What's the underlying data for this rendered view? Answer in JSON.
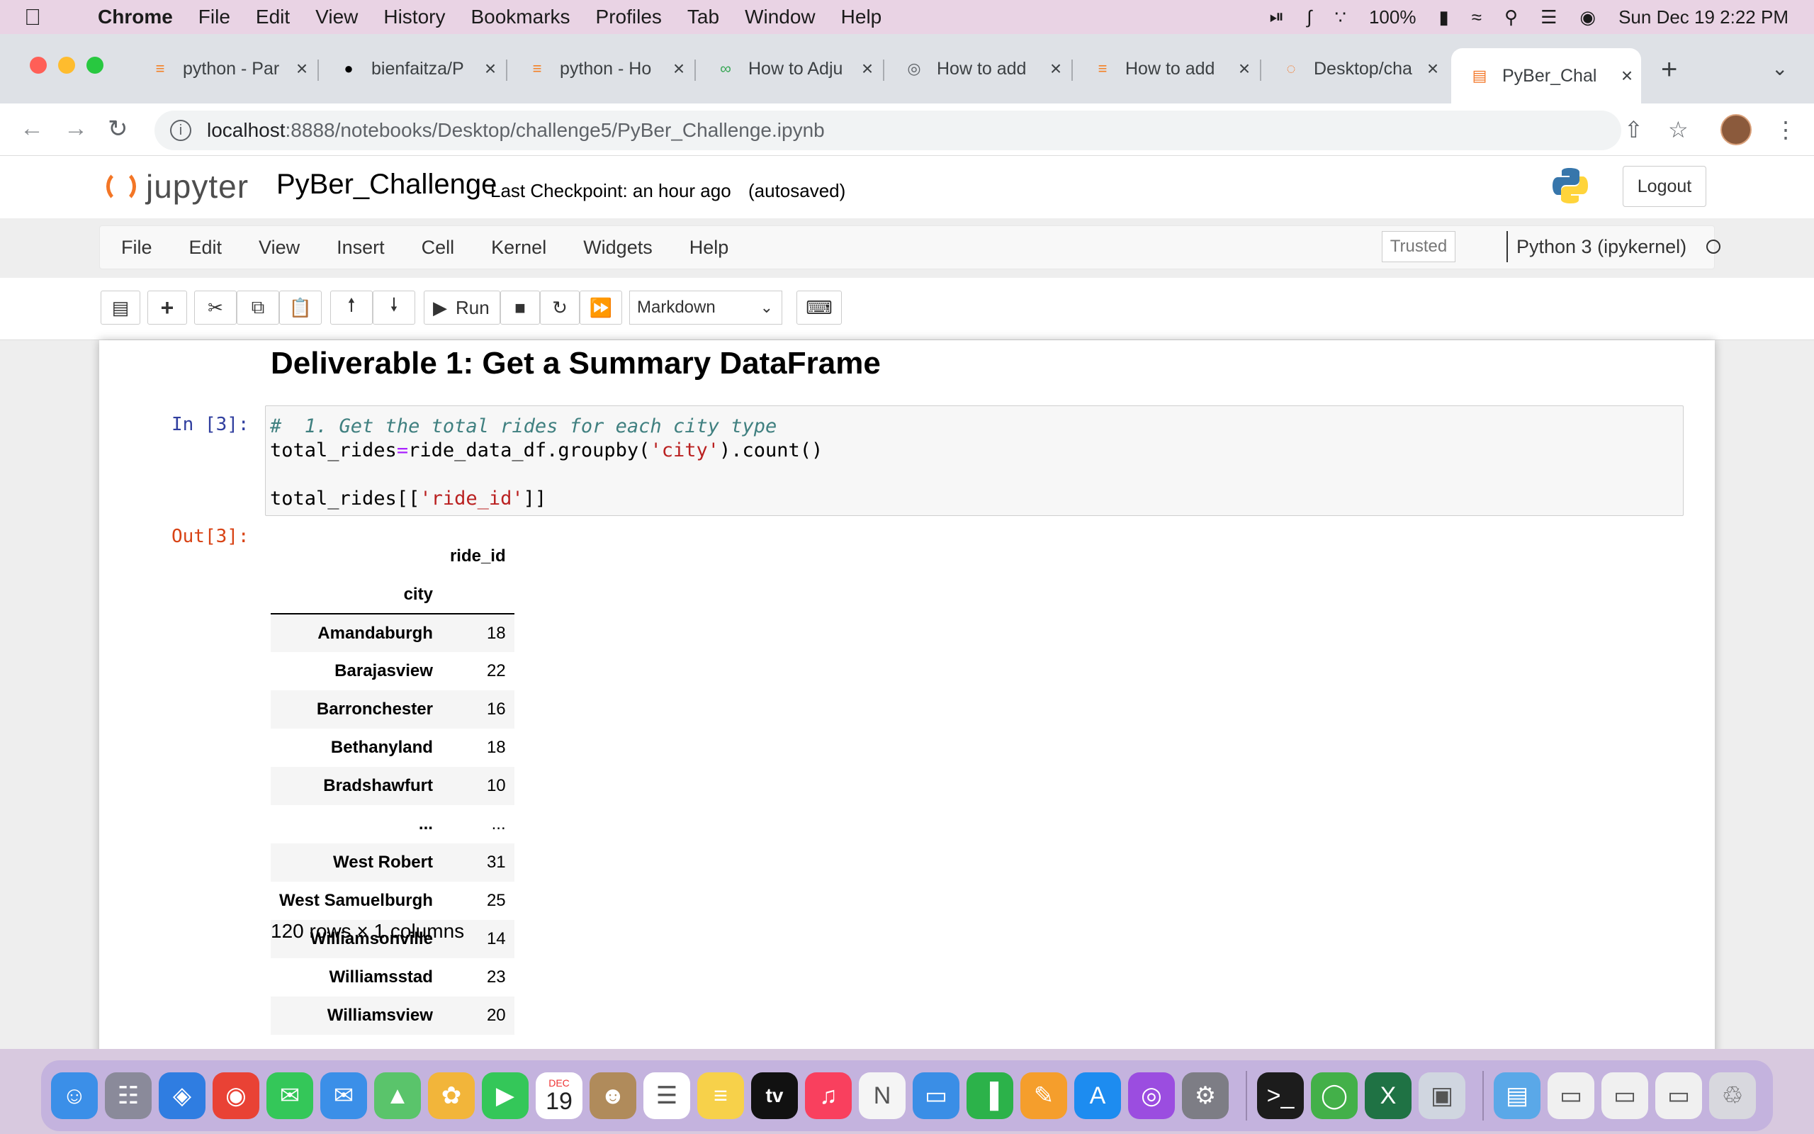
{
  "mac_menu": {
    "app": "Chrome",
    "items": [
      "File",
      "Edit",
      "View",
      "History",
      "Bookmarks",
      "Profiles",
      "Tab",
      "Window",
      "Help"
    ],
    "battery": "100%",
    "datetime": "Sun Dec 19  2:22 PM"
  },
  "tabs": [
    {
      "title": "python - Par",
      "icon": "stackoverflow-icon",
      "color": "#f48024"
    },
    {
      "title": "bienfaitza/P",
      "icon": "github-icon",
      "color": "#000000"
    },
    {
      "title": "python - Ho",
      "icon": "stackoverflow-icon",
      "color": "#f48024"
    },
    {
      "title": "How to Adju",
      "icon": "link-icon",
      "color": "#3aa757"
    },
    {
      "title": "How to add",
      "icon": "globe-icon",
      "color": "#5f6368"
    },
    {
      "title": "How to add",
      "icon": "stackoverflow-icon",
      "color": "#f48024"
    },
    {
      "title": "Desktop/cha",
      "icon": "jupyter-icon",
      "color": "#f37626"
    },
    {
      "title": "PyBer_Chal",
      "icon": "notebook-icon",
      "color": "#f37626",
      "active": true
    }
  ],
  "address": {
    "host": "localhost",
    "path": ":8888/notebooks/Desktop/challenge5/PyBer_Challenge.ipynb"
  },
  "jupyter": {
    "logo_text": "jupyter",
    "notebook_title": "PyBer_Challenge",
    "checkpoint": "Last Checkpoint: an hour ago",
    "autosaved": "(autosaved)",
    "logout": "Logout",
    "menu": [
      "File",
      "Edit",
      "View",
      "Insert",
      "Cell",
      "Kernel",
      "Widgets",
      "Help"
    ],
    "trusted": "Trusted",
    "kernel": "Python 3 (ipykernel)",
    "run_label": "Run",
    "cell_type": "Markdown"
  },
  "notebook": {
    "heading": "Deliverable 1: Get a Summary DataFrame",
    "in_prompt": "In [3]:",
    "out_prompt": "Out[3]:",
    "code": {
      "comment": "#  1. Get the total rides for each city type",
      "line2_a": "total_rides",
      "line2_op": "=",
      "line2_b": "ride_data_df.groupby(",
      "line2_str": "'city'",
      "line2_c": ").count()",
      "line4_a": "total_rides[[",
      "line4_str": "'ride_id'",
      "line4_b": "]]"
    },
    "table": {
      "column": "ride_id",
      "index_name": "city",
      "rows": [
        {
          "city": "Amandaburgh",
          "ride_id": "18"
        },
        {
          "city": "Barajasview",
          "ride_id": "22"
        },
        {
          "city": "Barronchester",
          "ride_id": "16"
        },
        {
          "city": "Bethanyland",
          "ride_id": "18"
        },
        {
          "city": "Bradshawfurt",
          "ride_id": "10"
        },
        {
          "city": "...",
          "ride_id": "..."
        },
        {
          "city": "West Robert",
          "ride_id": "31"
        },
        {
          "city": "West Samuelburgh",
          "ride_id": "25"
        },
        {
          "city": "Williamsonville",
          "ride_id": "14"
        },
        {
          "city": "Williamsstad",
          "ride_id": "23"
        },
        {
          "city": "Williamsview",
          "ride_id": "20"
        }
      ],
      "shape": "120 rows × 1 columns"
    }
  },
  "dock": {
    "calendar_month": "DEC",
    "calendar_day": "19",
    "tv_label": "tv",
    "apps": [
      {
        "name": "finder-icon",
        "color": "#3b8fe8"
      },
      {
        "name": "launchpad-icon",
        "color": "#8a8a9a"
      },
      {
        "name": "safari-icon",
        "color": "#2f7de1"
      },
      {
        "name": "chrome-icon",
        "color": "#e94235"
      },
      {
        "name": "messages-icon",
        "color": "#34c759"
      },
      {
        "name": "mail-icon",
        "color": "#3b8fe8"
      },
      {
        "name": "maps-icon",
        "color": "#5ac46b"
      },
      {
        "name": "photos-icon",
        "color": "#f2b53a"
      },
      {
        "name": "facetime-icon",
        "color": "#34c759"
      },
      {
        "name": "calendar-icon",
        "color": "#ffffff"
      },
      {
        "name": "contacts-icon",
        "color": "#b08b5b"
      },
      {
        "name": "reminders-icon",
        "color": "#ffffff"
      },
      {
        "name": "notes-icon",
        "color": "#f7d14a"
      },
      {
        "name": "appletv-icon",
        "color": "#111111"
      },
      {
        "name": "music-icon",
        "color": "#f9405e"
      },
      {
        "name": "news-icon",
        "color": "#f5f5f5"
      },
      {
        "name": "keynote-icon",
        "color": "#3a8ee6"
      },
      {
        "name": "numbers-icon",
        "color": "#2cb24a"
      },
      {
        "name": "pages-icon",
        "color": "#f59e2c"
      },
      {
        "name": "appstore-icon",
        "color": "#1d8cf0"
      },
      {
        "name": "podcasts-icon",
        "color": "#9b4de0"
      },
      {
        "name": "settings-icon",
        "color": "#7d7d85"
      },
      {
        "name": "terminal-icon",
        "color": "#1c1c1c"
      },
      {
        "name": "anaconda-icon",
        "color": "#43b049"
      },
      {
        "name": "excel-icon",
        "color": "#1f7244"
      },
      {
        "name": "preview-icon",
        "color": "#d0d6e0"
      },
      {
        "name": "folder-icon",
        "color": "#5aa8e8"
      },
      {
        "name": "window-thumb-icon",
        "color": "#f0f0f0"
      },
      {
        "name": "window-thumb-icon",
        "color": "#f0f0f0"
      },
      {
        "name": "window-thumb-icon",
        "color": "#f0f0f0"
      },
      {
        "name": "trash-icon",
        "color": "#d8d8de"
      }
    ]
  }
}
